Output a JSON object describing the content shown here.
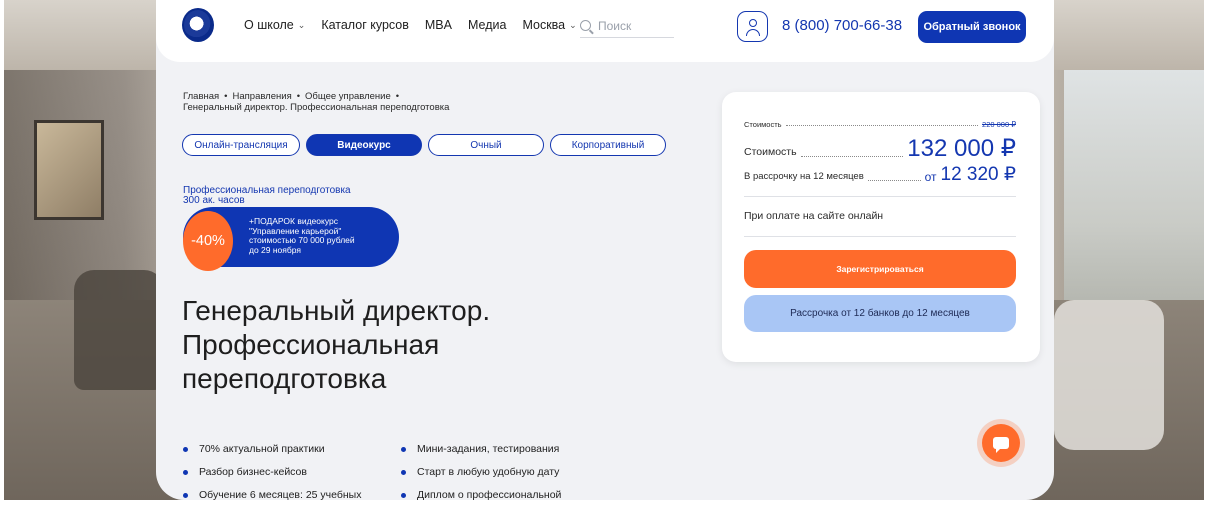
{
  "nav": {
    "items": [
      {
        "label": "О школе",
        "has_dropdown": true
      },
      {
        "label": "Каталог курсов",
        "has_dropdown": false
      },
      {
        "label": "MBA",
        "has_dropdown": false
      },
      {
        "label": "Медиа",
        "has_dropdown": false
      },
      {
        "label": "Москва",
        "has_dropdown": true
      }
    ],
    "search_placeholder": "Поиск",
    "phone": "8 (800) 700-66-38",
    "callback_label": "Обратный звонок"
  },
  "breadcrumb": {
    "items": [
      "Главная",
      "Направления",
      "Общее управление"
    ],
    "current": "Генеральный директор. Профессиональная переподготовка"
  },
  "formats": [
    "Онлайн-трансляция",
    "Видеокурс",
    "Очный",
    "Корпоративный"
  ],
  "active_format": "Видеокурс",
  "program": {
    "type": "Профессиональная переподготовка",
    "hours": "300 ак. часов"
  },
  "promo": {
    "discount": "-40%",
    "lines": [
      "+ПОДАРОК видеокурс",
      "\"Управление карьерой\"",
      "стоимостью 70 000 рублей",
      "до 29 ноября"
    ]
  },
  "title": "Генеральный директор. Профессиональная переподготовка",
  "features": [
    "70% актуальной практики",
    "Мини-задания, тестирования",
    "Разбор бизнес-кейсов",
    "Старт в любую удобную дату",
    "Обучение 6 месяцев: 25 учебных",
    "Диплом о профессиональной"
  ],
  "price": {
    "old_label": "Стоимость",
    "old_value": "220 000 ₽",
    "label": "Стоимость",
    "value": "132 000 ₽",
    "installment_label": "В рассрочку на 12 месяцев",
    "installment_from": "от",
    "installment_value": "12 320 ₽",
    "online_note": "При оплате на сайте онлайн",
    "register_label": "Зарегистрироваться",
    "loan_label": "Рассрочка от 12 банков до 12 месяцев"
  },
  "colors": {
    "accent": "#0f36b3",
    "orange": "#ff6b2b",
    "light_blue": "#a9c6f5"
  },
  "icons": [
    "logo-icon",
    "search-icon",
    "user-icon",
    "chat-icon"
  ]
}
